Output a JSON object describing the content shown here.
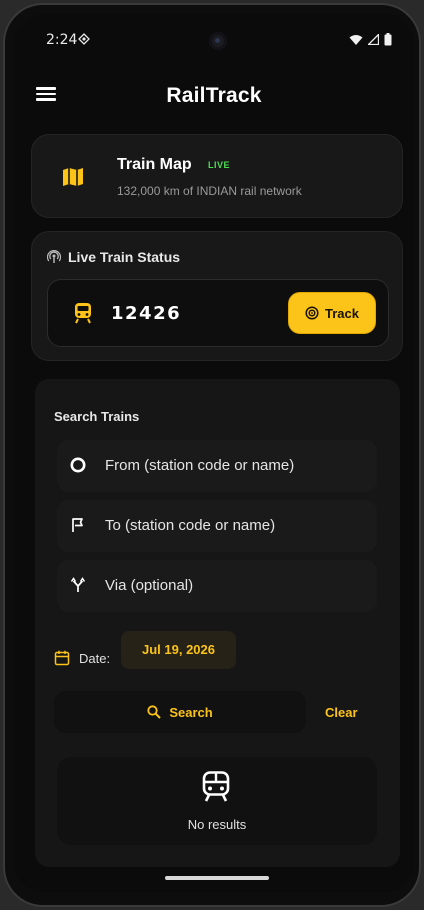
{
  "status_bar": {
    "time": "2:24"
  },
  "app_bar": {
    "title": "RailTrack"
  },
  "train_map": {
    "title": "Train Map",
    "badge": "LIVE",
    "subtitle": "132,000 km of INDIAN rail network"
  },
  "live_status": {
    "heading": "Live Train Status",
    "train_number": "12426",
    "track_label": "Track"
  },
  "search": {
    "heading": "Search Trains",
    "from_placeholder": "From (station code or name)",
    "to_placeholder": "To (station code or name)",
    "via_placeholder": "Via (optional)",
    "date_label": "Date:",
    "date_value": "Jul 19, 2026",
    "search_label": "Search",
    "clear_label": "Clear",
    "results_text": "No results"
  },
  "colors": {
    "accent": "#fcc419",
    "live": "#4ade52",
    "background": "#0b0b0b",
    "card": "#181818"
  }
}
